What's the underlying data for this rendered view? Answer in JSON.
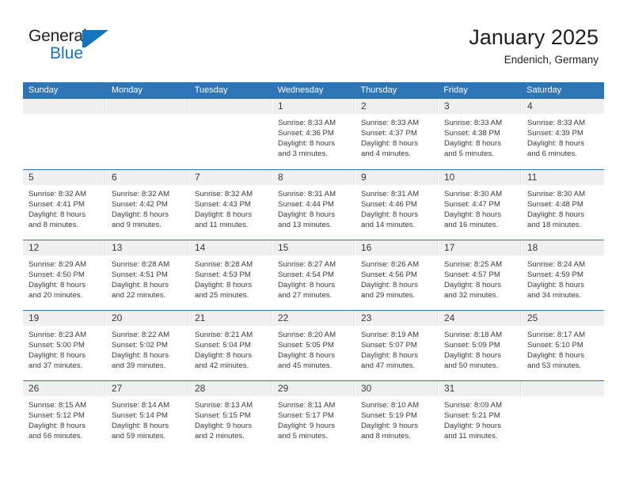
{
  "brand": {
    "word1": "General",
    "word2": "Blue",
    "accent_color": "#1673bd",
    "text_color": "#231f20"
  },
  "header": {
    "title": "January 2025",
    "subtitle": "Endenich, Germany"
  },
  "theme": {
    "header_blue": "#2f74b4",
    "daynum_band": "#f0f0f0",
    "body_text": "#3b3b3b"
  },
  "calendar": {
    "weekday_headers": [
      "Sunday",
      "Monday",
      "Tuesday",
      "Wednesday",
      "Thursday",
      "Friday",
      "Saturday"
    ],
    "labels": {
      "sunrise": "Sunrise:",
      "sunset": "Sunset:",
      "daylight": "Daylight:"
    },
    "weeks": [
      [
        {
          "day": "",
          "empty": true
        },
        {
          "day": "",
          "empty": true
        },
        {
          "day": "",
          "empty": true
        },
        {
          "day": "1",
          "l1": "Sunrise: 8:33 AM",
          "l2": "Sunset: 4:36 PM",
          "l3": "Daylight: 8 hours",
          "l4": "and 3 minutes."
        },
        {
          "day": "2",
          "l1": "Sunrise: 8:33 AM",
          "l2": "Sunset: 4:37 PM",
          "l3": "Daylight: 8 hours",
          "l4": "and 4 minutes."
        },
        {
          "day": "3",
          "l1": "Sunrise: 8:33 AM",
          "l2": "Sunset: 4:38 PM",
          "l3": "Daylight: 8 hours",
          "l4": "and 5 minutes."
        },
        {
          "day": "4",
          "l1": "Sunrise: 8:33 AM",
          "l2": "Sunset: 4:39 PM",
          "l3": "Daylight: 8 hours",
          "l4": "and 6 minutes."
        }
      ],
      [
        {
          "day": "5",
          "l1": "Sunrise: 8:32 AM",
          "l2": "Sunset: 4:41 PM",
          "l3": "Daylight: 8 hours",
          "l4": "and 8 minutes."
        },
        {
          "day": "6",
          "l1": "Sunrise: 8:32 AM",
          "l2": "Sunset: 4:42 PM",
          "l3": "Daylight: 8 hours",
          "l4": "and 9 minutes."
        },
        {
          "day": "7",
          "l1": "Sunrise: 8:32 AM",
          "l2": "Sunset: 4:43 PM",
          "l3": "Daylight: 8 hours",
          "l4": "and 11 minutes."
        },
        {
          "day": "8",
          "l1": "Sunrise: 8:31 AM",
          "l2": "Sunset: 4:44 PM",
          "l3": "Daylight: 8 hours",
          "l4": "and 13 minutes."
        },
        {
          "day": "9",
          "l1": "Sunrise: 8:31 AM",
          "l2": "Sunset: 4:46 PM",
          "l3": "Daylight: 8 hours",
          "l4": "and 14 minutes."
        },
        {
          "day": "10",
          "l1": "Sunrise: 8:30 AM",
          "l2": "Sunset: 4:47 PM",
          "l3": "Daylight: 8 hours",
          "l4": "and 16 minutes."
        },
        {
          "day": "11",
          "l1": "Sunrise: 8:30 AM",
          "l2": "Sunset: 4:48 PM",
          "l3": "Daylight: 8 hours",
          "l4": "and 18 minutes."
        }
      ],
      [
        {
          "day": "12",
          "l1": "Sunrise: 8:29 AM",
          "l2": "Sunset: 4:50 PM",
          "l3": "Daylight: 8 hours",
          "l4": "and 20 minutes."
        },
        {
          "day": "13",
          "l1": "Sunrise: 8:28 AM",
          "l2": "Sunset: 4:51 PM",
          "l3": "Daylight: 8 hours",
          "l4": "and 22 minutes."
        },
        {
          "day": "14",
          "l1": "Sunrise: 8:28 AM",
          "l2": "Sunset: 4:53 PM",
          "l3": "Daylight: 8 hours",
          "l4": "and 25 minutes."
        },
        {
          "day": "15",
          "l1": "Sunrise: 8:27 AM",
          "l2": "Sunset: 4:54 PM",
          "l3": "Daylight: 8 hours",
          "l4": "and 27 minutes."
        },
        {
          "day": "16",
          "l1": "Sunrise: 8:26 AM",
          "l2": "Sunset: 4:56 PM",
          "l3": "Daylight: 8 hours",
          "l4": "and 29 minutes."
        },
        {
          "day": "17",
          "l1": "Sunrise: 8:25 AM",
          "l2": "Sunset: 4:57 PM",
          "l3": "Daylight: 8 hours",
          "l4": "and 32 minutes."
        },
        {
          "day": "18",
          "l1": "Sunrise: 8:24 AM",
          "l2": "Sunset: 4:59 PM",
          "l3": "Daylight: 8 hours",
          "l4": "and 34 minutes."
        }
      ],
      [
        {
          "day": "19",
          "l1": "Sunrise: 8:23 AM",
          "l2": "Sunset: 5:00 PM",
          "l3": "Daylight: 8 hours",
          "l4": "and 37 minutes."
        },
        {
          "day": "20",
          "l1": "Sunrise: 8:22 AM",
          "l2": "Sunset: 5:02 PM",
          "l3": "Daylight: 8 hours",
          "l4": "and 39 minutes."
        },
        {
          "day": "21",
          "l1": "Sunrise: 8:21 AM",
          "l2": "Sunset: 5:04 PM",
          "l3": "Daylight: 8 hours",
          "l4": "and 42 minutes."
        },
        {
          "day": "22",
          "l1": "Sunrise: 8:20 AM",
          "l2": "Sunset: 5:05 PM",
          "l3": "Daylight: 8 hours",
          "l4": "and 45 minutes."
        },
        {
          "day": "23",
          "l1": "Sunrise: 8:19 AM",
          "l2": "Sunset: 5:07 PM",
          "l3": "Daylight: 8 hours",
          "l4": "and 47 minutes."
        },
        {
          "day": "24",
          "l1": "Sunrise: 8:18 AM",
          "l2": "Sunset: 5:09 PM",
          "l3": "Daylight: 8 hours",
          "l4": "and 50 minutes."
        },
        {
          "day": "25",
          "l1": "Sunrise: 8:17 AM",
          "l2": "Sunset: 5:10 PM",
          "l3": "Daylight: 8 hours",
          "l4": "and 53 minutes."
        }
      ],
      [
        {
          "day": "26",
          "l1": "Sunrise: 8:15 AM",
          "l2": "Sunset: 5:12 PM",
          "l3": "Daylight: 8 hours",
          "l4": "and 56 minutes."
        },
        {
          "day": "27",
          "l1": "Sunrise: 8:14 AM",
          "l2": "Sunset: 5:14 PM",
          "l3": "Daylight: 8 hours",
          "l4": "and 59 minutes."
        },
        {
          "day": "28",
          "l1": "Sunrise: 8:13 AM",
          "l2": "Sunset: 5:15 PM",
          "l3": "Daylight: 9 hours",
          "l4": "and 2 minutes."
        },
        {
          "day": "29",
          "l1": "Sunrise: 8:11 AM",
          "l2": "Sunset: 5:17 PM",
          "l3": "Daylight: 9 hours",
          "l4": "and 5 minutes."
        },
        {
          "day": "30",
          "l1": "Sunrise: 8:10 AM",
          "l2": "Sunset: 5:19 PM",
          "l3": "Daylight: 9 hours",
          "l4": "and 8 minutes."
        },
        {
          "day": "31",
          "l1": "Sunrise: 8:09 AM",
          "l2": "Sunset: 5:21 PM",
          "l3": "Daylight: 9 hours",
          "l4": "and 11 minutes."
        },
        {
          "day": "",
          "empty": true
        }
      ]
    ]
  }
}
